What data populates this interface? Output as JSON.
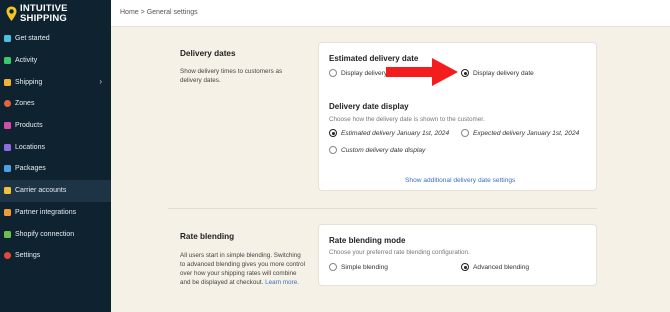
{
  "brand": {
    "line1": "INTUITIVE",
    "line2": "SHIPPING",
    "accent": "#f3c623"
  },
  "sidebar": {
    "items": [
      {
        "label": "Get started",
        "icon": "rocket-icon",
        "color": "#4ac1e0"
      },
      {
        "label": "Activity",
        "icon": "activity-icon",
        "color": "#39c86a"
      },
      {
        "label": "Shipping",
        "icon": "truck-icon",
        "color": "#f2b233"
      },
      {
        "label": "Zones",
        "icon": "globe-icon",
        "color": "#e5643a"
      },
      {
        "label": "Products",
        "icon": "shirt-icon",
        "color": "#d94ab0"
      },
      {
        "label": "Locations",
        "icon": "building-icon",
        "color": "#8e6de0"
      },
      {
        "label": "Packages",
        "icon": "boxes-icon",
        "color": "#4aa2e0"
      },
      {
        "label": "Carrier accounts",
        "icon": "key-icon",
        "color": "#f2c33a"
      },
      {
        "label": "Partner integrations",
        "icon": "plug-icon",
        "color": "#f29a3a"
      },
      {
        "label": "Shopify connection",
        "icon": "shopify-icon",
        "color": "#6cc04a"
      },
      {
        "label": "Settings",
        "icon": "gear-icon",
        "color": "#e5483a"
      }
    ],
    "chevron": "›"
  },
  "breadcrumb": {
    "home": "Home",
    "separator": ">",
    "current": "General settings"
  },
  "delivery": {
    "title": "Delivery dates",
    "description": "Show delivery times to customers as delivery dates.",
    "estimated": {
      "title": "Estimated delivery date",
      "option_hidden": "Display delivery d",
      "option_shown": "Display delivery date"
    },
    "display": {
      "title": "Delivery date display",
      "subtitle": "Choose how the delivery date is shown to the customer.",
      "option1": "Estimated delivery January 1st, 2024",
      "option2": "Expected delivery January 1st, 2024",
      "option3": "Custom delivery date display"
    },
    "link": "Show additional delivery date settings"
  },
  "blending": {
    "title": "Rate blending",
    "description": "All users start in simple blending. Switching to advanced blending gives you more control over how your shipping rates will combine and be displayed at checkout.",
    "learn_more": "Learn more.",
    "mode_title": "Rate blending mode",
    "mode_subtitle": "Choose your preferred rate blending configuration.",
    "option_simple": "Simple blending",
    "option_advanced": "Advanced blending"
  },
  "annotation": {
    "arrow_color": "#f41d1d"
  }
}
